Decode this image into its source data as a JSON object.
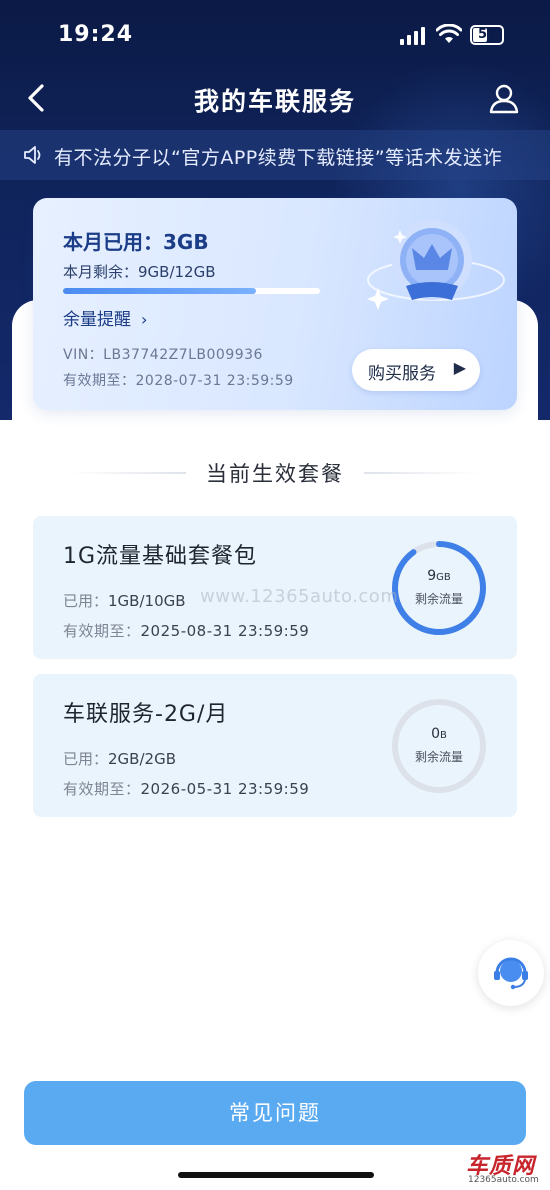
{
  "status_bar": {
    "time": "19:24",
    "battery": "51"
  },
  "nav": {
    "title": "我的车联服务"
  },
  "notice": {
    "text": "有不法分子以“官方APP续费下载链接”等话术发送诈"
  },
  "usage": {
    "used_title": "本月已用：3GB",
    "remaining": "本月剩余：9GB/12GB",
    "remaining_fraction": 0.75,
    "reminder_label": "余量提醒",
    "vin": "VIN：LB37742Z7LB009936",
    "valid": "有效期至：2028-07-31 23:59:59",
    "buy_label": "购买服务"
  },
  "section": {
    "title": "当前生效套餐"
  },
  "packages": [
    {
      "name": "1G流量基础套餐包",
      "used_label": "已用：",
      "used_value": "1GB/10GB",
      "valid_label": "有效期至：",
      "valid_value": "2025-08-31 23:59:59",
      "ring_value": "9",
      "ring_unit": "GB",
      "ring_label": "剩余流量",
      "ring_fraction": 0.9,
      "ring_color": "#3f7fe8"
    },
    {
      "name": "车联服务-2G/月",
      "used_label": "已用：",
      "used_value": "2GB/2GB",
      "valid_label": "有效期至：",
      "valid_value": "2026-05-31 23:59:59",
      "ring_value": "0",
      "ring_unit": "B",
      "ring_label": "剩余流量",
      "ring_fraction": 0.0,
      "ring_color": "#3f7fe8"
    }
  ],
  "watermark": "www.12365auto.com",
  "footer": {
    "faq_label": "常见问题"
  },
  "site_logo": {
    "name": "车质网",
    "url": "12365auto.com"
  },
  "colors": {
    "accent": "#5aaaf2",
    "header_bg": "#0b1a46",
    "card_bg": "#eaf4fc"
  }
}
